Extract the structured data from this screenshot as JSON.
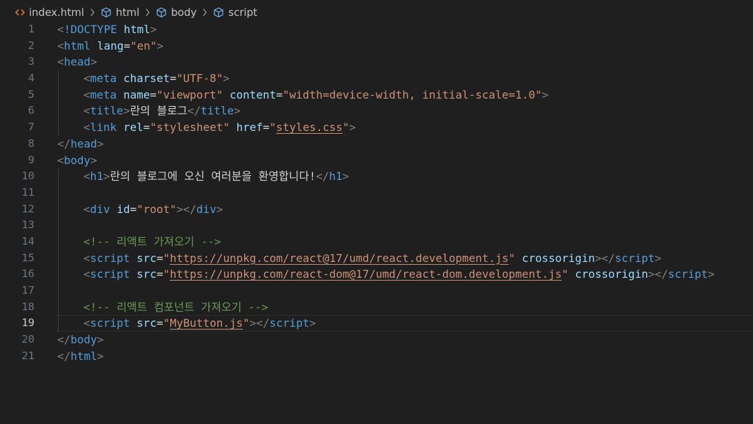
{
  "breadcrumb": {
    "items": [
      {
        "label": "index.html",
        "icon": "html-file-icon"
      },
      {
        "label": "html",
        "icon": "element-cube-icon"
      },
      {
        "label": "body",
        "icon": "element-cube-icon"
      },
      {
        "label": "script",
        "icon": "element-cube-icon"
      }
    ]
  },
  "editor": {
    "current_line": 19,
    "colors": {
      "background": "#1f1f1f",
      "tag": "#569cd6",
      "attribute": "#9cdcfe",
      "string": "#ce9178",
      "comment": "#6a9955",
      "text": "#d4d4d4",
      "angle_bracket": "#808080",
      "line_number": "#6e7681"
    },
    "lines": [
      {
        "num": "1",
        "indent": 0,
        "tokens": [
          [
            "ang",
            "<"
          ],
          [
            "tag",
            "!DOCTYPE"
          ],
          [
            "txt",
            " "
          ],
          [
            "attr",
            "html"
          ],
          [
            "ang",
            ">"
          ]
        ]
      },
      {
        "num": "2",
        "indent": 0,
        "tokens": [
          [
            "ang",
            "<"
          ],
          [
            "tag",
            "html"
          ],
          [
            "txt",
            " "
          ],
          [
            "attr",
            "lang"
          ],
          [
            "txt",
            "="
          ],
          [
            "str",
            "\"en\""
          ],
          [
            "ang",
            ">"
          ]
        ]
      },
      {
        "num": "3",
        "indent": 0,
        "tokens": [
          [
            "ang",
            "<"
          ],
          [
            "tag",
            "head"
          ],
          [
            "ang",
            ">"
          ]
        ]
      },
      {
        "num": "4",
        "indent": 1,
        "tokens": [
          [
            "ang",
            "<"
          ],
          [
            "tag",
            "meta"
          ],
          [
            "txt",
            " "
          ],
          [
            "attr",
            "charset"
          ],
          [
            "txt",
            "="
          ],
          [
            "str",
            "\"UTF-8\""
          ],
          [
            "ang",
            ">"
          ]
        ]
      },
      {
        "num": "5",
        "indent": 1,
        "tokens": [
          [
            "ang",
            "<"
          ],
          [
            "tag",
            "meta"
          ],
          [
            "txt",
            " "
          ],
          [
            "attr",
            "name"
          ],
          [
            "txt",
            "="
          ],
          [
            "str",
            "\"viewport\""
          ],
          [
            "txt",
            " "
          ],
          [
            "attr",
            "content"
          ],
          [
            "txt",
            "="
          ],
          [
            "str",
            "\"width=device-width, initial-scale=1.0\""
          ],
          [
            "ang",
            ">"
          ]
        ]
      },
      {
        "num": "6",
        "indent": 1,
        "tokens": [
          [
            "ang",
            "<"
          ],
          [
            "tag",
            "title"
          ],
          [
            "ang",
            ">"
          ],
          [
            "txt",
            "란의 블로그"
          ],
          [
            "ang",
            "</"
          ],
          [
            "tag",
            "title"
          ],
          [
            "ang",
            ">"
          ]
        ]
      },
      {
        "num": "7",
        "indent": 1,
        "tokens": [
          [
            "ang",
            "<"
          ],
          [
            "tag",
            "link"
          ],
          [
            "txt",
            " "
          ],
          [
            "attr",
            "rel"
          ],
          [
            "txt",
            "="
          ],
          [
            "str",
            "\"stylesheet\""
          ],
          [
            "txt",
            " "
          ],
          [
            "attr",
            "href"
          ],
          [
            "txt",
            "="
          ],
          [
            "str",
            "\""
          ],
          [
            "strlink",
            "styles.css"
          ],
          [
            "str",
            "\""
          ],
          [
            "ang",
            ">"
          ]
        ]
      },
      {
        "num": "8",
        "indent": 0,
        "tokens": [
          [
            "ang",
            "</"
          ],
          [
            "tag",
            "head"
          ],
          [
            "ang",
            ">"
          ]
        ]
      },
      {
        "num": "9",
        "indent": 0,
        "tokens": [
          [
            "ang",
            "<"
          ],
          [
            "tag",
            "body"
          ],
          [
            "ang",
            ">"
          ]
        ]
      },
      {
        "num": "10",
        "indent": 1,
        "tokens": [
          [
            "ang",
            "<"
          ],
          [
            "tag",
            "h1"
          ],
          [
            "ang",
            ">"
          ],
          [
            "txt",
            "란의 블로그에 오신 여러분을 환영합니다!"
          ],
          [
            "ang",
            "</"
          ],
          [
            "tag",
            "h1"
          ],
          [
            "ang",
            ">"
          ]
        ]
      },
      {
        "num": "11",
        "indent": 1,
        "tokens": []
      },
      {
        "num": "12",
        "indent": 1,
        "tokens": [
          [
            "ang",
            "<"
          ],
          [
            "tag",
            "div"
          ],
          [
            "txt",
            " "
          ],
          [
            "attr",
            "id"
          ],
          [
            "txt",
            "="
          ],
          [
            "str",
            "\"root\""
          ],
          [
            "ang",
            "></"
          ],
          [
            "tag",
            "div"
          ],
          [
            "ang",
            ">"
          ]
        ]
      },
      {
        "num": "13",
        "indent": 1,
        "tokens": []
      },
      {
        "num": "14",
        "indent": 1,
        "tokens": [
          [
            "com",
            "<!-- 리액트 가져오기 -->"
          ]
        ]
      },
      {
        "num": "15",
        "indent": 1,
        "tokens": [
          [
            "ang",
            "<"
          ],
          [
            "tag",
            "script"
          ],
          [
            "txt",
            " "
          ],
          [
            "attr",
            "src"
          ],
          [
            "txt",
            "="
          ],
          [
            "str",
            "\""
          ],
          [
            "strlink",
            "https://unpkg.com/react@17/umd/react.development.js"
          ],
          [
            "str",
            "\""
          ],
          [
            "txt",
            " "
          ],
          [
            "attr",
            "crossorigin"
          ],
          [
            "ang",
            "></"
          ],
          [
            "tag",
            "script"
          ],
          [
            "ang",
            ">"
          ]
        ]
      },
      {
        "num": "16",
        "indent": 1,
        "tokens": [
          [
            "ang",
            "<"
          ],
          [
            "tag",
            "script"
          ],
          [
            "txt",
            " "
          ],
          [
            "attr",
            "src"
          ],
          [
            "txt",
            "="
          ],
          [
            "str",
            "\""
          ],
          [
            "strlink",
            "https://unpkg.com/react-dom@17/umd/react-dom.development.js"
          ],
          [
            "str",
            "\""
          ],
          [
            "txt",
            " "
          ],
          [
            "attr",
            "crossorigin"
          ],
          [
            "ang",
            "></"
          ],
          [
            "tag",
            "script"
          ],
          [
            "ang",
            ">"
          ]
        ]
      },
      {
        "num": "17",
        "indent": 1,
        "tokens": []
      },
      {
        "num": "18",
        "indent": 1,
        "tokens": [
          [
            "com",
            "<!-- 리액트 컴포넌트 가져오기 -->"
          ]
        ]
      },
      {
        "num": "19",
        "indent": 1,
        "tokens": [
          [
            "ang",
            "<"
          ],
          [
            "tag",
            "script"
          ],
          [
            "txt",
            " "
          ],
          [
            "attr",
            "src"
          ],
          [
            "txt",
            "="
          ],
          [
            "str",
            "\""
          ],
          [
            "strlink",
            "MyButton.js"
          ],
          [
            "str",
            "\""
          ],
          [
            "ang",
            "></"
          ],
          [
            "tag",
            "script"
          ],
          [
            "ang",
            ">"
          ]
        ]
      },
      {
        "num": "20",
        "indent": 0,
        "tokens": [
          [
            "ang",
            "</"
          ],
          [
            "tag",
            "body"
          ],
          [
            "ang",
            ">"
          ]
        ]
      },
      {
        "num": "21",
        "indent": 0,
        "tokens": [
          [
            "ang",
            "</"
          ],
          [
            "tag",
            "html"
          ],
          [
            "ang",
            ">"
          ]
        ]
      }
    ]
  }
}
